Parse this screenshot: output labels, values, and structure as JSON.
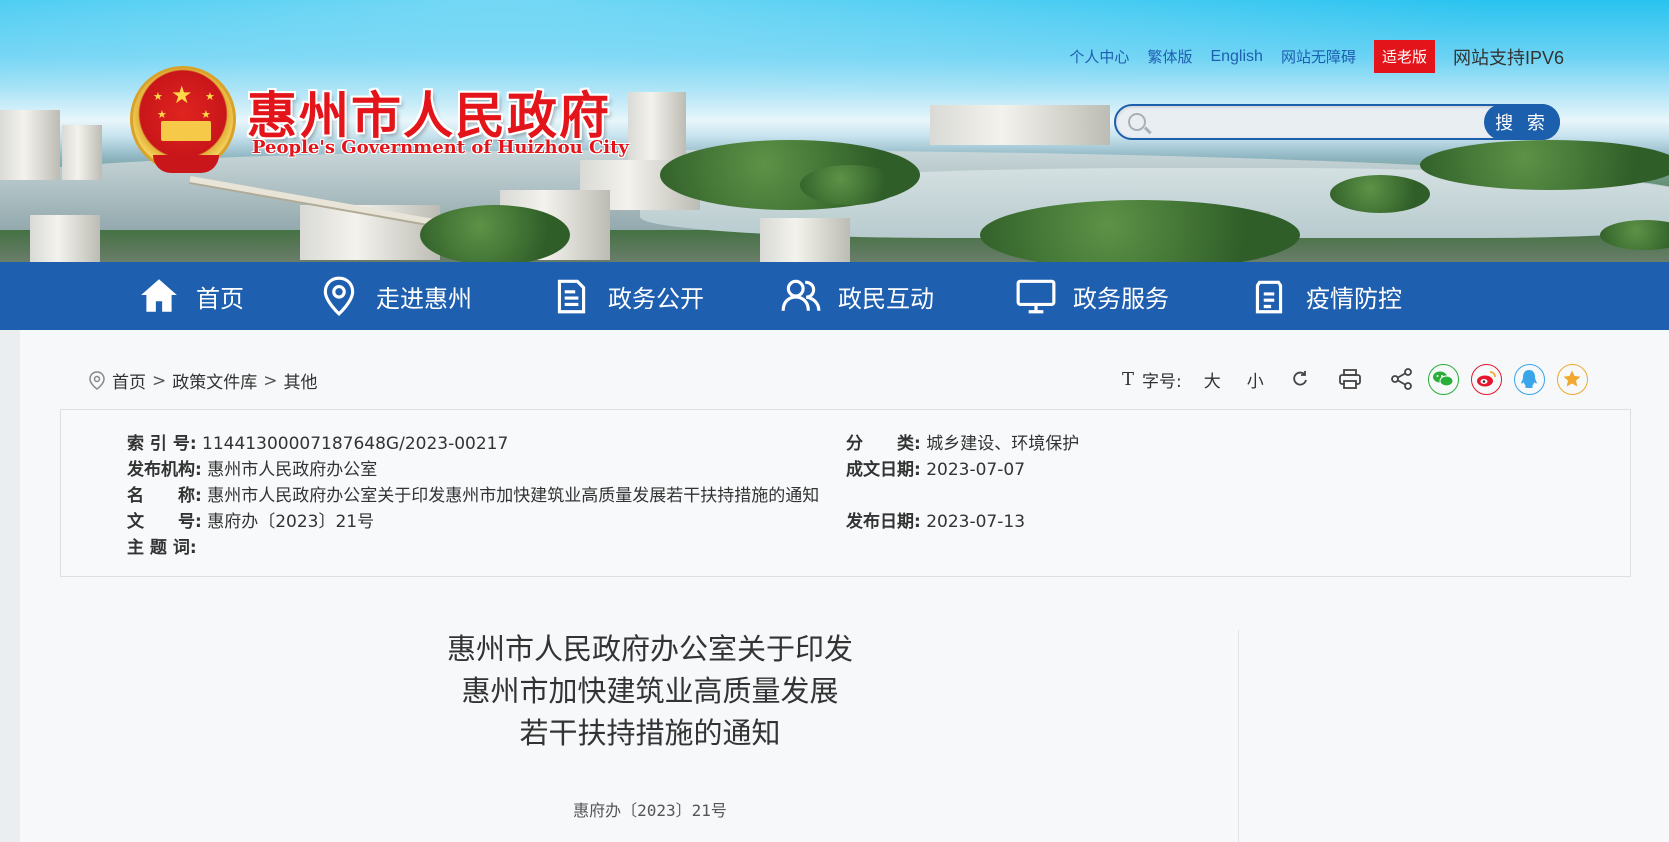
{
  "header": {
    "site_title": "惠州市人民政府",
    "site_subtitle": "People's Government of Huizhou City",
    "top_links": [
      "个人中心",
      "繁体版",
      "English",
      "网站无障碍"
    ],
    "elder_mode": "适老版",
    "ipv6_text": "网站支持IPV6",
    "search": {
      "placeholder": "",
      "button_label": "搜 索"
    }
  },
  "nav": {
    "items": [
      {
        "label": "首页",
        "icon": "home-icon"
      },
      {
        "label": "走进惠州",
        "icon": "location-pin-icon"
      },
      {
        "label": "政务公开",
        "icon": "document-icon"
      },
      {
        "label": "政民互动",
        "icon": "people-icon"
      },
      {
        "label": "政务服务",
        "icon": "monitor-icon"
      },
      {
        "label": "疫情防控",
        "icon": "clipboard-icon"
      }
    ]
  },
  "breadcrumb": {
    "items": [
      "首页",
      "政策文件库",
      "其他"
    ],
    "separator": ">"
  },
  "tools": {
    "font_icon": "T",
    "font_label": "字号:",
    "large": "大",
    "small": "小",
    "share_colors": {
      "wechat": "#2aae3a",
      "weibo": "#e6162d",
      "qq": "#3aa5e8",
      "favorite": "#f0a92e"
    }
  },
  "meta": {
    "index_label": "索 引 号:",
    "index_value": "11441300007187648G/2023-00217",
    "category_label": "分　　类:",
    "category_value": "城乡建设、环境保护",
    "publisher_label": "发布机构:",
    "publisher_value": "惠州市人民政府办公室",
    "written_label": "成文日期:",
    "written_value": "2023-07-07",
    "name_label": "名　　称:",
    "name_value": "惠州市人民政府办公室关于印发惠州市加快建筑业高质量发展若干扶持措施的通知",
    "docno_label": "文　　号:",
    "docno_value": "惠府办〔2023〕21号",
    "published_label": "发布日期:",
    "published_value": "2023-07-13",
    "keywords_label": "主 题 词:",
    "keywords_value": ""
  },
  "document": {
    "title_lines": [
      "惠州市人民政府办公室关于印发",
      "惠州市加快建筑业高质量发展",
      "若干扶持措施的通知"
    ],
    "doc_number": "惠府办〔2023〕21号"
  }
}
